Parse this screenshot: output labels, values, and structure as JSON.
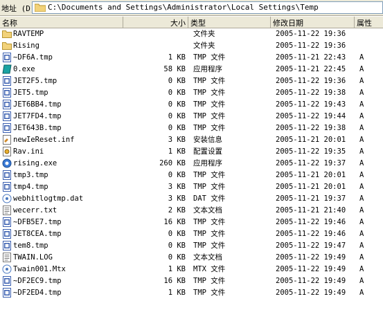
{
  "address": {
    "label": "地址 (D)",
    "path": "C:\\Documents and Settings\\Administrator\\Local Settings\\Temp"
  },
  "columns": {
    "name": "名称",
    "size": "大小",
    "type": "类型",
    "modified": "修改日期",
    "attributes": "属性"
  },
  "files": [
    {
      "name": "RAVTEMP",
      "size": "",
      "type": "文件夹",
      "modified": "2005-11-22 19:36",
      "attr": "",
      "icon": "folder-icon"
    },
    {
      "name": "Rising",
      "size": "",
      "type": "文件夹",
      "modified": "2005-11-22 19:36",
      "attr": "",
      "icon": "folder-icon"
    },
    {
      "name": "~DF6A.tmp",
      "size": "1 KB",
      "type": "TMP 文件",
      "modified": "2005-11-21 22:43",
      "attr": "A",
      "icon": "tmp-file-icon"
    },
    {
      "name": "0.exe",
      "size": "58 KB",
      "type": "应用程序",
      "modified": "2005-11-21 22:45",
      "attr": "A",
      "icon": "exe-icon"
    },
    {
      "name": "JET2F5.tmp",
      "size": "0 KB",
      "type": "TMP 文件",
      "modified": "2005-11-22 19:36",
      "attr": "A",
      "icon": "tmp-file-icon"
    },
    {
      "name": "JET5.tmp",
      "size": "0 KB",
      "type": "TMP 文件",
      "modified": "2005-11-22 19:38",
      "attr": "A",
      "icon": "tmp-file-icon"
    },
    {
      "name": "JET6BB4.tmp",
      "size": "0 KB",
      "type": "TMP 文件",
      "modified": "2005-11-22 19:43",
      "attr": "A",
      "icon": "tmp-file-icon"
    },
    {
      "name": "JET7FD4.tmp",
      "size": "0 KB",
      "type": "TMP 文件",
      "modified": "2005-11-22 19:44",
      "attr": "A",
      "icon": "tmp-file-icon"
    },
    {
      "name": "JET643B.tmp",
      "size": "0 KB",
      "type": "TMP 文件",
      "modified": "2005-11-22 19:38",
      "attr": "A",
      "icon": "tmp-file-icon"
    },
    {
      "name": "newIeReset.inf",
      "size": "3 KB",
      "type": "安装信息",
      "modified": "2005-11-21 20:01",
      "attr": "A",
      "icon": "inf-file-icon"
    },
    {
      "name": "Rav.ini",
      "size": "1 KB",
      "type": "配置设置",
      "modified": "2005-11-22 19:35",
      "attr": "A",
      "icon": "ini-file-icon"
    },
    {
      "name": "rising.exe",
      "size": "260 KB",
      "type": "应用程序",
      "modified": "2005-11-22 19:37",
      "attr": "A",
      "icon": "app-icon"
    },
    {
      "name": "tmp3.tmp",
      "size": "0 KB",
      "type": "TMP 文件",
      "modified": "2005-11-21 20:01",
      "attr": "A",
      "icon": "tmp-file-icon"
    },
    {
      "name": "tmp4.tmp",
      "size": "3 KB",
      "type": "TMP 文件",
      "modified": "2005-11-21 20:01",
      "attr": "A",
      "icon": "tmp-file-icon"
    },
    {
      "name": "webhitlogtmp.dat",
      "size": "3 KB",
      "type": "DAT 文件",
      "modified": "2005-11-21 19:37",
      "attr": "A",
      "icon": "dat-file-icon"
    },
    {
      "name": "wecerr.txt",
      "size": "2 KB",
      "type": "文本文档",
      "modified": "2005-11-21 21:40",
      "attr": "A",
      "icon": "txt-file-icon"
    },
    {
      "name": "~DFB5E7.tmp",
      "size": "16 KB",
      "type": "TMP 文件",
      "modified": "2005-11-22 19:46",
      "attr": "A",
      "icon": "tmp-file-icon"
    },
    {
      "name": "JET8CEA.tmp",
      "size": "0 KB",
      "type": "TMP 文件",
      "modified": "2005-11-22 19:46",
      "attr": "A",
      "icon": "tmp-file-icon"
    },
    {
      "name": "tem8.tmp",
      "size": "0 KB",
      "type": "TMP 文件",
      "modified": "2005-11-22 19:47",
      "attr": "A",
      "icon": "tmp-file-icon"
    },
    {
      "name": "TWAIN.LOG",
      "size": "0 KB",
      "type": "文本文档",
      "modified": "2005-11-22 19:49",
      "attr": "A",
      "icon": "txt-file-icon"
    },
    {
      "name": "Twain001.Mtx",
      "size": "1 KB",
      "type": "MTX 文件",
      "modified": "2005-11-22 19:49",
      "attr": "A",
      "icon": "dat-file-icon"
    },
    {
      "name": "~DF2EC9.tmp",
      "size": "16 KB",
      "type": "TMP 文件",
      "modified": "2005-11-22 19:49",
      "attr": "A",
      "icon": "tmp-file-icon"
    },
    {
      "name": "~DF2ED4.tmp",
      "size": "1 KB",
      "type": "TMP 文件",
      "modified": "2005-11-22 19:49",
      "attr": "A",
      "icon": "tmp-file-icon"
    }
  ],
  "colors": {
    "folder": "#f2d27a",
    "tmp_icon": "#3a5fb0",
    "exe_icon": "#1aa3a3",
    "selection_border": "#7f9db9"
  }
}
